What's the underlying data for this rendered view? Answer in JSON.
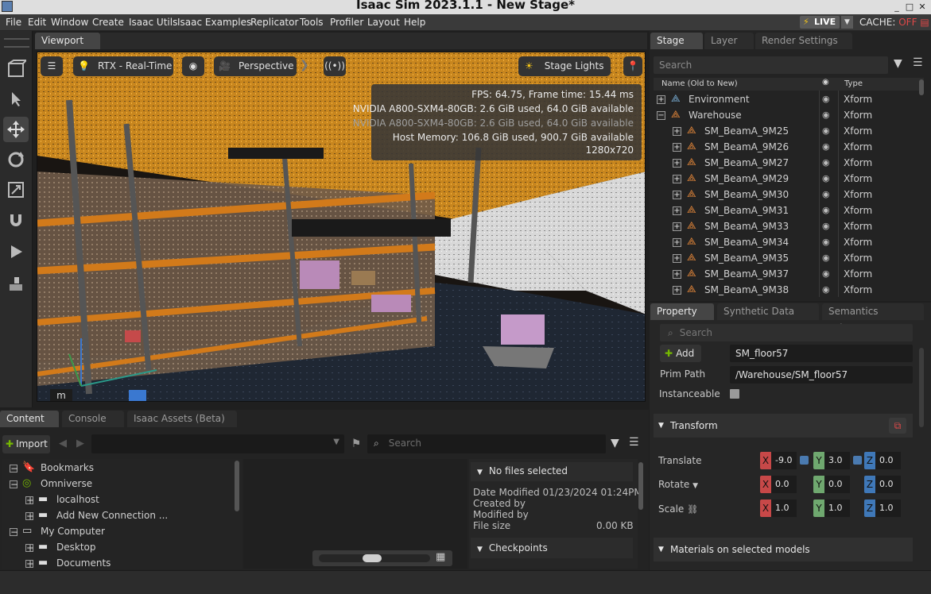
{
  "window": {
    "title": "Isaac Sim 2023.1.1 - New Stage*",
    "minimize": "_",
    "maximize": "□",
    "close": "✕"
  },
  "menu": [
    "File",
    "Edit",
    "Window",
    "Create",
    "Isaac Utils",
    "Isaac Examples",
    "Replicator",
    "Tools",
    "Profiler",
    "Layout",
    "Help"
  ],
  "live": {
    "label": "LIVE",
    "cache_label": "CACHE:",
    "cache_state": "OFF"
  },
  "viewport": {
    "tab": "Viewport",
    "renderer": "RTX - Real-Time",
    "camera": "Perspective",
    "lights": "Stage Lights",
    "units_badge": "m",
    "stats": {
      "fps": "FPS: 64.75, Frame time: 15.44 ms",
      "gpu1": "NVIDIA A800-SXM4-80GB: 2.6 GiB used, 64.0 GiB available",
      "gpu2": "NVIDIA A800-SXM4-80GB: 2.6 GiB used, 64.0 GiB available",
      "host": "Host Memory: 106.8 GiB used, 900.7 GiB available",
      "res": "1280x720"
    }
  },
  "stage": {
    "tabs": [
      "Stage",
      "Layer",
      "Render Settings"
    ],
    "search_placeholder": "Search",
    "col_name": "Name (Old to New)",
    "col_type": "Type",
    "rows": [
      {
        "name": "Environment",
        "type": "Xform",
        "exp": "+"
      },
      {
        "name": "Warehouse",
        "type": "Xform",
        "exp": "−"
      },
      {
        "name": "SM_BeamA_9M25",
        "type": "Xform",
        "exp": "+"
      },
      {
        "name": "SM_BeamA_9M26",
        "type": "Xform",
        "exp": "+"
      },
      {
        "name": "SM_BeamA_9M27",
        "type": "Xform",
        "exp": "+"
      },
      {
        "name": "SM_BeamA_9M29",
        "type": "Xform",
        "exp": "+"
      },
      {
        "name": "SM_BeamA_9M30",
        "type": "Xform",
        "exp": "+"
      },
      {
        "name": "SM_BeamA_9M31",
        "type": "Xform",
        "exp": "+"
      },
      {
        "name": "SM_BeamA_9M33",
        "type": "Xform",
        "exp": "+"
      },
      {
        "name": "SM_BeamA_9M34",
        "type": "Xform",
        "exp": "+"
      },
      {
        "name": "SM_BeamA_9M35",
        "type": "Xform",
        "exp": "+"
      },
      {
        "name": "SM_BeamA_9M37",
        "type": "Xform",
        "exp": "+"
      },
      {
        "name": "SM_BeamA_9M38",
        "type": "Xform",
        "exp": "+"
      }
    ]
  },
  "property": {
    "tabs": [
      "Property",
      "Synthetic Data Rec...",
      "Semantics Schema..."
    ],
    "search_placeholder": "Search",
    "add_label": "Add",
    "prim_name": "SM_floor57",
    "prim_path_label": "Prim Path",
    "prim_path": "/Warehouse/SM_floor57",
    "instanceable_label": "Instanceable",
    "transform_label": "Transform",
    "translate_label": "Translate",
    "rotate_label": "Rotate",
    "scale_label": "Scale",
    "translate": [
      "-9.0",
      "3.0",
      "0.0"
    ],
    "rotate": [
      "0.0",
      "0.0",
      "0.0"
    ],
    "scale": [
      "1.0",
      "1.0",
      "1.0"
    ],
    "axes": [
      "X",
      "Y",
      "Z"
    ],
    "materials_label": "Materials on selected models"
  },
  "content": {
    "tabs": [
      "Content",
      "Console",
      "Isaac Assets (Beta)"
    ],
    "import_label": "Import",
    "search_placeholder": "Search",
    "tree": [
      {
        "label": "Bookmarks",
        "exp": "−"
      },
      {
        "label": "Omniverse",
        "exp": "−"
      },
      {
        "label": "localhost",
        "exp": "+"
      },
      {
        "label": "Add New Connection ...",
        "exp": "+"
      },
      {
        "label": "My Computer",
        "exp": "−"
      },
      {
        "label": "Desktop",
        "exp": "+"
      },
      {
        "label": "Documents",
        "exp": "+"
      }
    ],
    "details": {
      "header": "No files selected",
      "date_label": "Date Modified",
      "date_value": "01/23/2024 01:24PM",
      "created": "Created by",
      "modified": "Modified by",
      "size_label": "File size",
      "size_value": "0.00 KB",
      "checkpoints": "Checkpoints"
    }
  },
  "colors": {
    "accent": "#76b900",
    "live": "#f5c518",
    "cache_off": "#e04848",
    "x": "#c74848",
    "y": "#6fa86f",
    "z": "#3f78b8"
  }
}
